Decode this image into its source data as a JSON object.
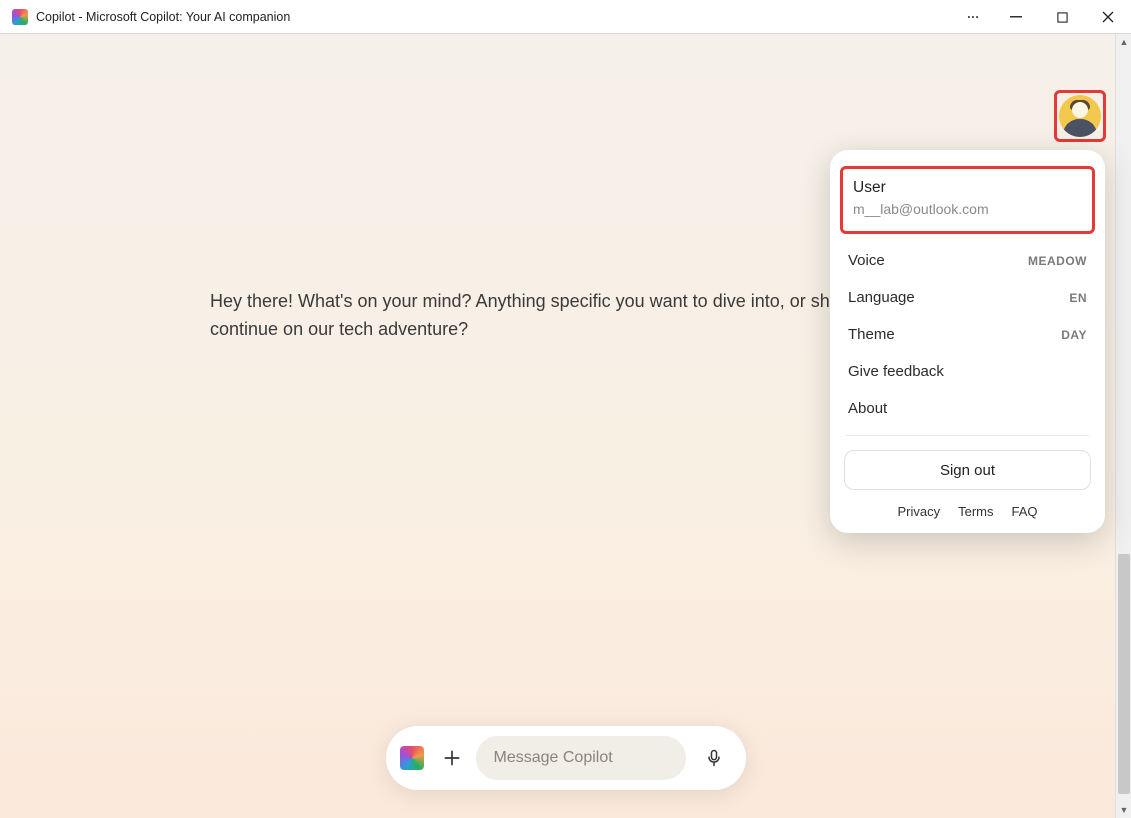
{
  "window": {
    "title": "Copilot - Microsoft Copilot: Your AI companion"
  },
  "assistant": {
    "message": "Hey there! What's on your mind? Anything specific you want to dive into, or should we continue on our tech adventure?"
  },
  "user_menu": {
    "name": "User",
    "email": "m__lab@outlook.com",
    "items": {
      "voice": {
        "label": "Voice",
        "value": "MEADOW"
      },
      "language": {
        "label": "Language",
        "value": "EN"
      },
      "theme": {
        "label": "Theme",
        "value": "DAY"
      },
      "feedback": {
        "label": "Give feedback"
      },
      "about": {
        "label": "About"
      }
    },
    "signout": "Sign out",
    "links": {
      "privacy": "Privacy",
      "terms": "Terms",
      "faq": "FAQ"
    }
  },
  "composer": {
    "placeholder": "Message Copilot"
  }
}
